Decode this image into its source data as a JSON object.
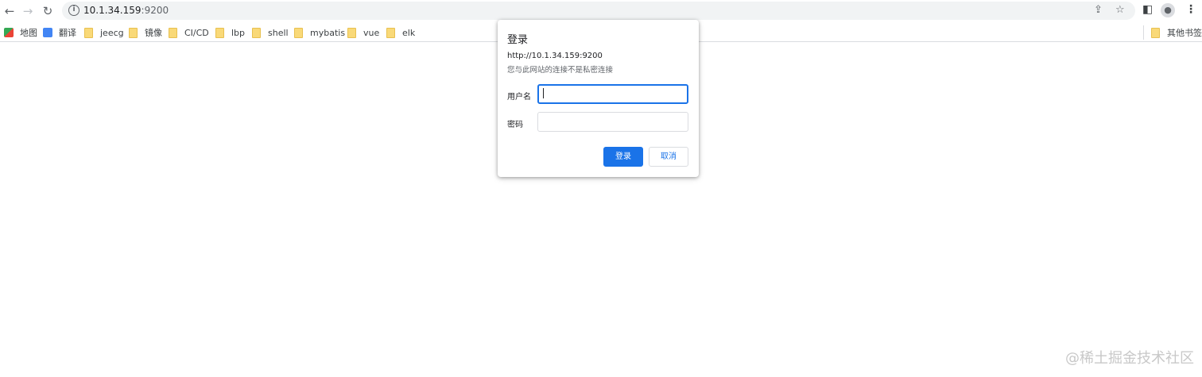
{
  "browser": {
    "url_host": "10.1.34.159",
    "url_port": ":9200",
    "bookmarks": [
      {
        "label": "地图",
        "icon": "maps-icon"
      },
      {
        "label": "翻译",
        "icon": "translate-icon"
      },
      {
        "label": "jeecg",
        "icon": "folder-icon"
      },
      {
        "label": "镜像",
        "icon": "folder-icon"
      },
      {
        "label": "CI/CD",
        "icon": "folder-icon"
      },
      {
        "label": "lbp",
        "icon": "folder-icon"
      },
      {
        "label": "shell",
        "icon": "folder-icon"
      },
      {
        "label": "mybatis",
        "icon": "folder-icon"
      },
      {
        "label": "vue",
        "icon": "folder-icon"
      },
      {
        "label": "elk",
        "icon": "folder-icon"
      }
    ],
    "other_bookmarks": "其他书签"
  },
  "dialog": {
    "title": "登录",
    "origin": "http://10.1.34.159:9200",
    "note": "您与此网站的连接不是私密连接",
    "username_label": "用户名",
    "username_value": "",
    "password_label": "密码",
    "password_value": "",
    "login_button": "登录",
    "cancel_button": "取消"
  },
  "watermark": "@稀土掘金技术社区",
  "colors": {
    "accent": "#1a73e8",
    "folder": "#f9d978"
  }
}
